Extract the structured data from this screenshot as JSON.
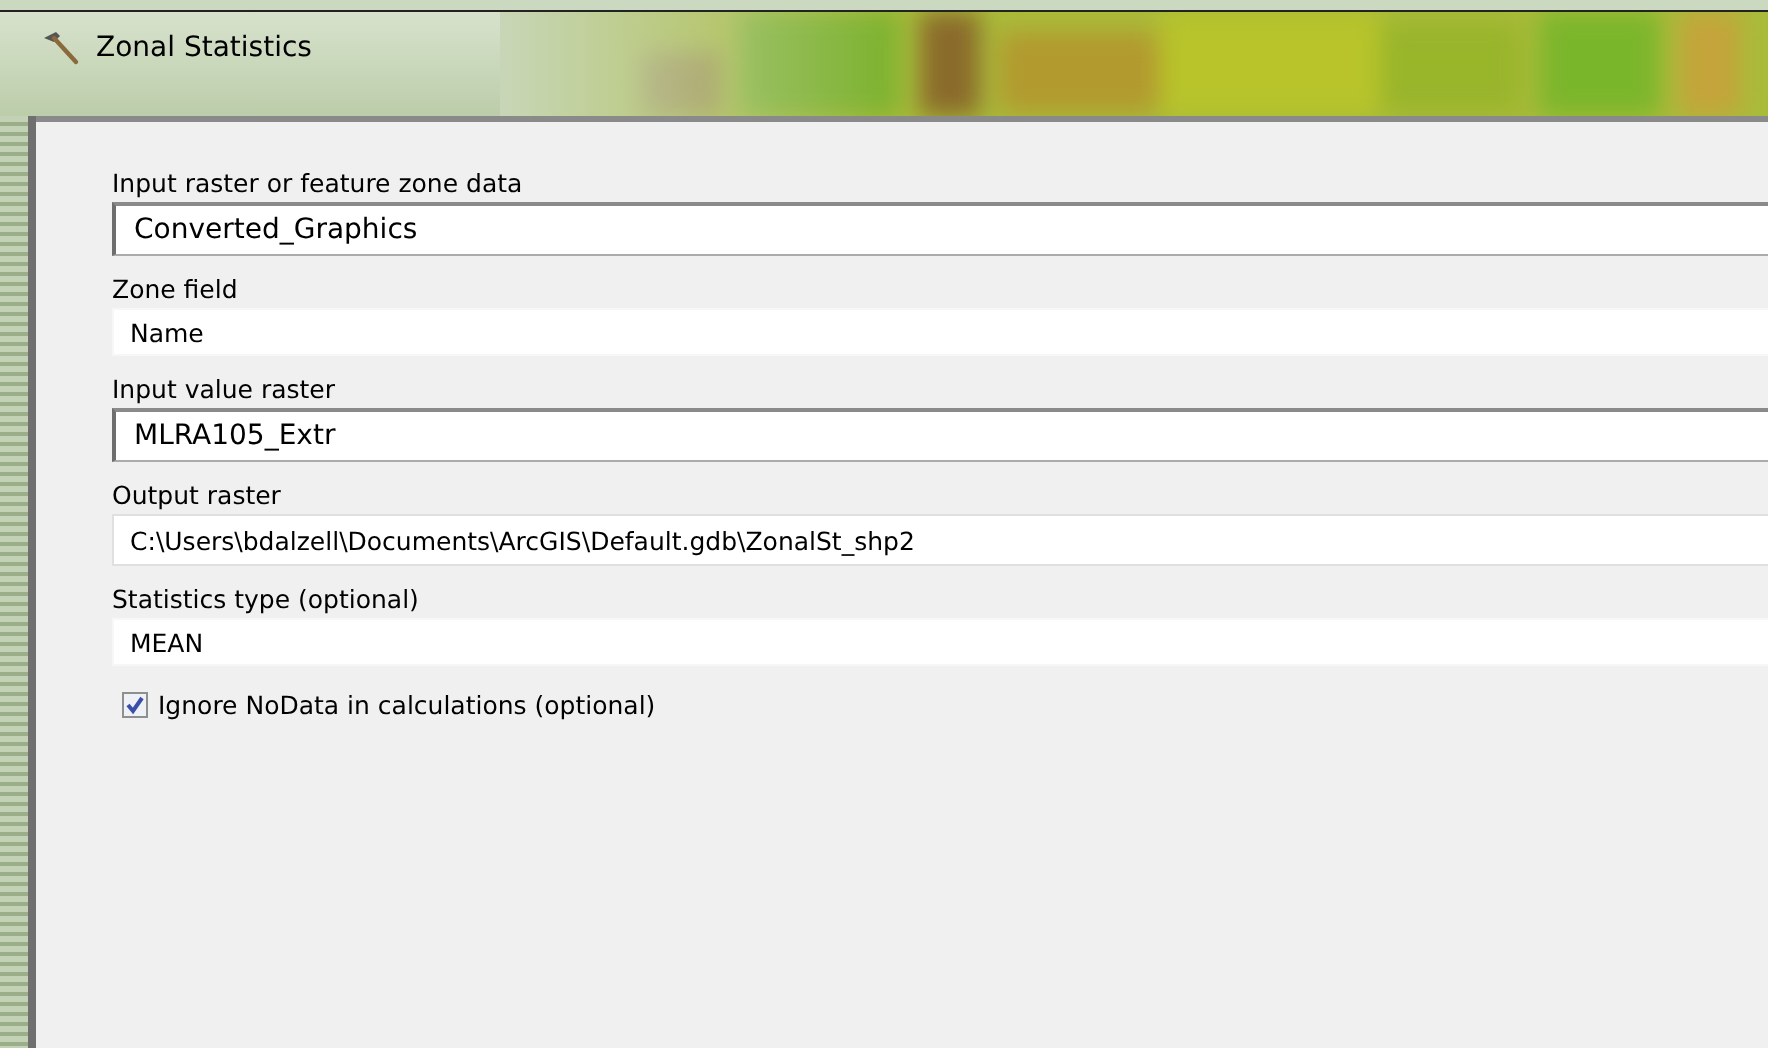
{
  "window": {
    "title": "Zonal Statistics"
  },
  "parameters": [
    {
      "label": "Input raster or feature zone data",
      "kind": "input",
      "value": "Converted_Graphics"
    },
    {
      "label": "Zone field",
      "kind": "select",
      "value": "Name"
    },
    {
      "label": "Input value raster",
      "kind": "input",
      "value": "MLRA105_Extr"
    },
    {
      "label": "Output raster",
      "kind": "text",
      "value": "C:\\Users\\bdalzell\\Documents\\ArcGIS\\Default.gdb\\ZonalSt_shp2"
    },
    {
      "label": "Statistics type (optional)",
      "kind": "select",
      "value": "MEAN"
    }
  ],
  "option": {
    "label": "Ignore NoData in calculations (optional)",
    "checked": true
  }
}
